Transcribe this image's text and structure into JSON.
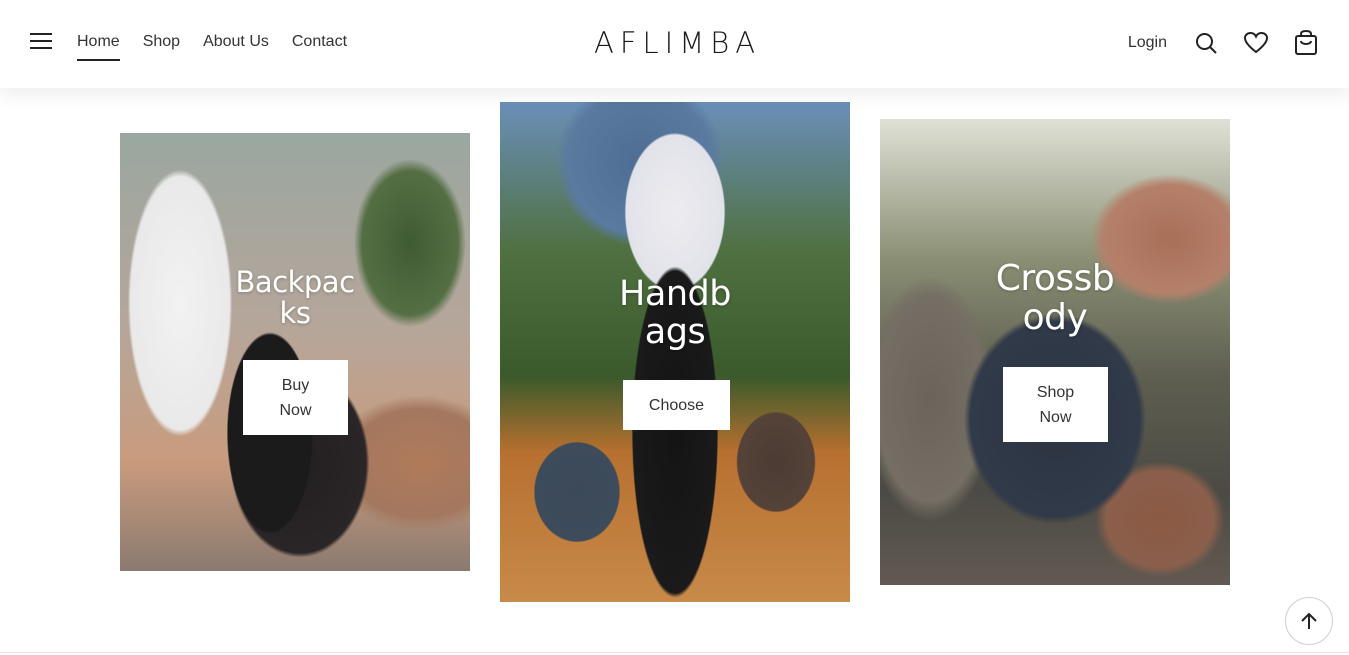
{
  "header": {
    "nav": [
      {
        "label": "Home",
        "active": true
      },
      {
        "label": "Shop",
        "active": false
      },
      {
        "label": "About Us",
        "active": false
      },
      {
        "label": "Contact",
        "active": false
      }
    ],
    "logo_text": "AFLIMBA",
    "login_label": "Login",
    "icons": [
      "menu-icon",
      "search-icon",
      "heart-icon",
      "cart-icon"
    ]
  },
  "categories": [
    {
      "title": "Backpacks",
      "title_lines": [
        "Backpac",
        "ks"
      ],
      "cta_lines": [
        "Buy",
        "Now"
      ]
    },
    {
      "title": "Handbags",
      "title_lines": [
        "Handb",
        "ags"
      ],
      "cta_lines": [
        "Choose"
      ]
    },
    {
      "title": "Crossbody",
      "title_lines": [
        "Crossb",
        "ody"
      ],
      "cta_lines": [
        "Shop",
        "Now"
      ]
    }
  ],
  "colors": {
    "text": "#222222",
    "background": "#ffffff",
    "overlay_text": "#ffffff"
  },
  "scroll_top_icon": "arrow-up-icon"
}
